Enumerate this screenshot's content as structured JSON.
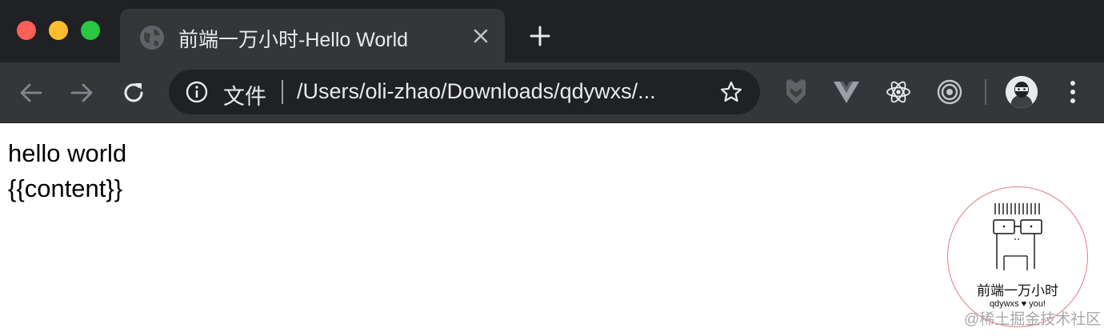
{
  "window": {
    "controls": [
      "close",
      "minimize",
      "maximize"
    ]
  },
  "tab": {
    "title": "前端一万小时-Hello World",
    "favicon": "globe-icon"
  },
  "toolbar": {
    "back_icon": "arrow-left-icon",
    "forward_icon": "arrow-right-icon",
    "reload_icon": "reload-icon",
    "omnibox": {
      "scheme_label": "文件",
      "url": "/Users/oli-zhao/Downloads/qdywxs/...",
      "info_icon": "info-icon",
      "bookmark_icon": "star-icon"
    },
    "extensions": [
      "shield-extension-icon",
      "vue-devtools-icon",
      "react-devtools-icon",
      "target-extension-icon"
    ],
    "menu_icon": "kebab-menu-icon"
  },
  "page": {
    "lines": [
      "hello world",
      "{{content}}"
    ]
  },
  "badge": {
    "title": "前端一万小时",
    "subtitle": "qdywxs ♥ you!"
  },
  "watermark": "@稀土掘金技术社区",
  "colors": {
    "titlebar": "#202124",
    "toolbar": "#35363a",
    "omnibox": "#202124",
    "badge_border": "#e87a84"
  }
}
